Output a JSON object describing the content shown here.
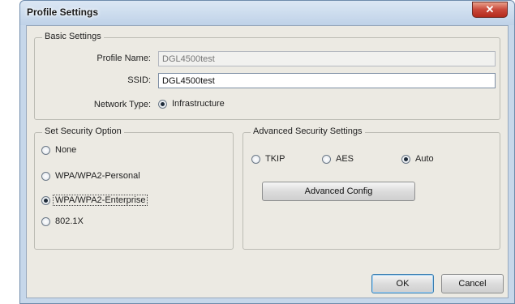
{
  "window": {
    "title": "Profile Settings",
    "close_glyph": "✕"
  },
  "basic_settings": {
    "legend": "Basic Settings",
    "profile_name_label": "Profile Name:",
    "profile_name_value": "DGL4500test",
    "ssid_label": "SSID:",
    "ssid_value": "DGL4500test",
    "network_type_label": "Network Type:",
    "network_type_value": "Infrastructure"
  },
  "security": {
    "legend": "Set Security Option",
    "options": [
      "None",
      "WPA/WPA2-Personal",
      "WPA/WPA2-Enterprise",
      "802.1X"
    ],
    "selected": "WPA/WPA2-Enterprise"
  },
  "advanced": {
    "legend": "Advanced Security Settings",
    "options": [
      "TKIP",
      "AES",
      "Auto"
    ],
    "selected": "Auto",
    "config_button": "Advanced Config"
  },
  "footer": {
    "ok_label": "OK",
    "cancel_label": "Cancel"
  },
  "icons": {
    "close": "close-icon",
    "radio": "radio-icon"
  }
}
